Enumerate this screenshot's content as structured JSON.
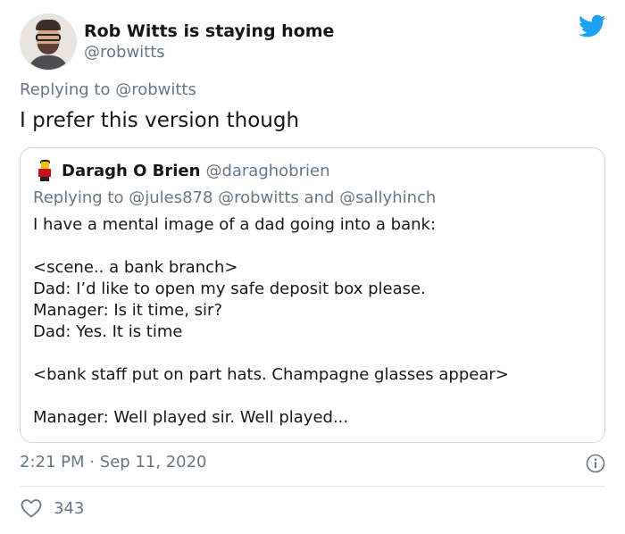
{
  "tweet": {
    "author_name": "Rob Witts is staying home",
    "author_handle": "@robwitts",
    "replying_to_prefix": "Replying to ",
    "replying_to_handle": "@robwitts",
    "text": "I prefer this version though",
    "timestamp": "2:21 PM · Sep 11, 2020",
    "like_count": "343"
  },
  "quote": {
    "author_name": "Daragh O Brien",
    "author_handle": "@daraghobrien",
    "replying_to_prefix": "Replying to ",
    "replying_to_handles": [
      "@jules878",
      "@robwitts"
    ],
    "replying_to_and": " and ",
    "replying_to_last": "@sallyhinch",
    "lines": [
      "I have a mental image of a dad going into a bank:",
      "",
      "<scene.. a bank branch>",
      "Dad: I’d like to open my safe deposit box please.",
      "Manager: Is it time, sir?",
      "Dad: Yes. It is time",
      "",
      "<bank staff put on part hats. Champagne glasses appear>",
      "",
      "Manager: Well played sir. Well played..."
    ]
  },
  "icons": {
    "brand": "twitter-bird-icon",
    "info": "info-icon",
    "like": "heart-icon"
  },
  "colors": {
    "twitter_blue": "#1da1f2",
    "secondary_text": "#657786",
    "primary_text": "#14171a",
    "border": "#ccd6dd"
  }
}
